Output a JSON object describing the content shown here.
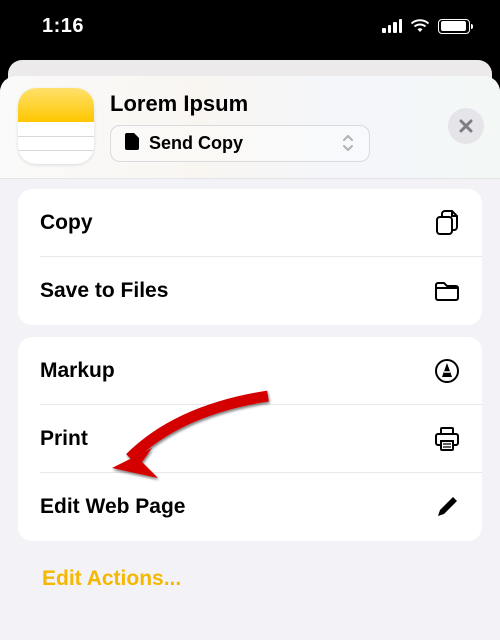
{
  "statusbar": {
    "time": "1:16"
  },
  "header": {
    "title": "Lorem Ipsum",
    "send_copy_label": "Send Copy"
  },
  "group1": {
    "items": [
      {
        "label": "Copy"
      },
      {
        "label": "Save to Files"
      }
    ]
  },
  "group2": {
    "items": [
      {
        "label": "Markup"
      },
      {
        "label": "Print"
      },
      {
        "label": "Edit Web Page"
      }
    ]
  },
  "footer": {
    "edit_actions": "Edit Actions..."
  },
  "annotation": {
    "arrow_target": "Print"
  }
}
